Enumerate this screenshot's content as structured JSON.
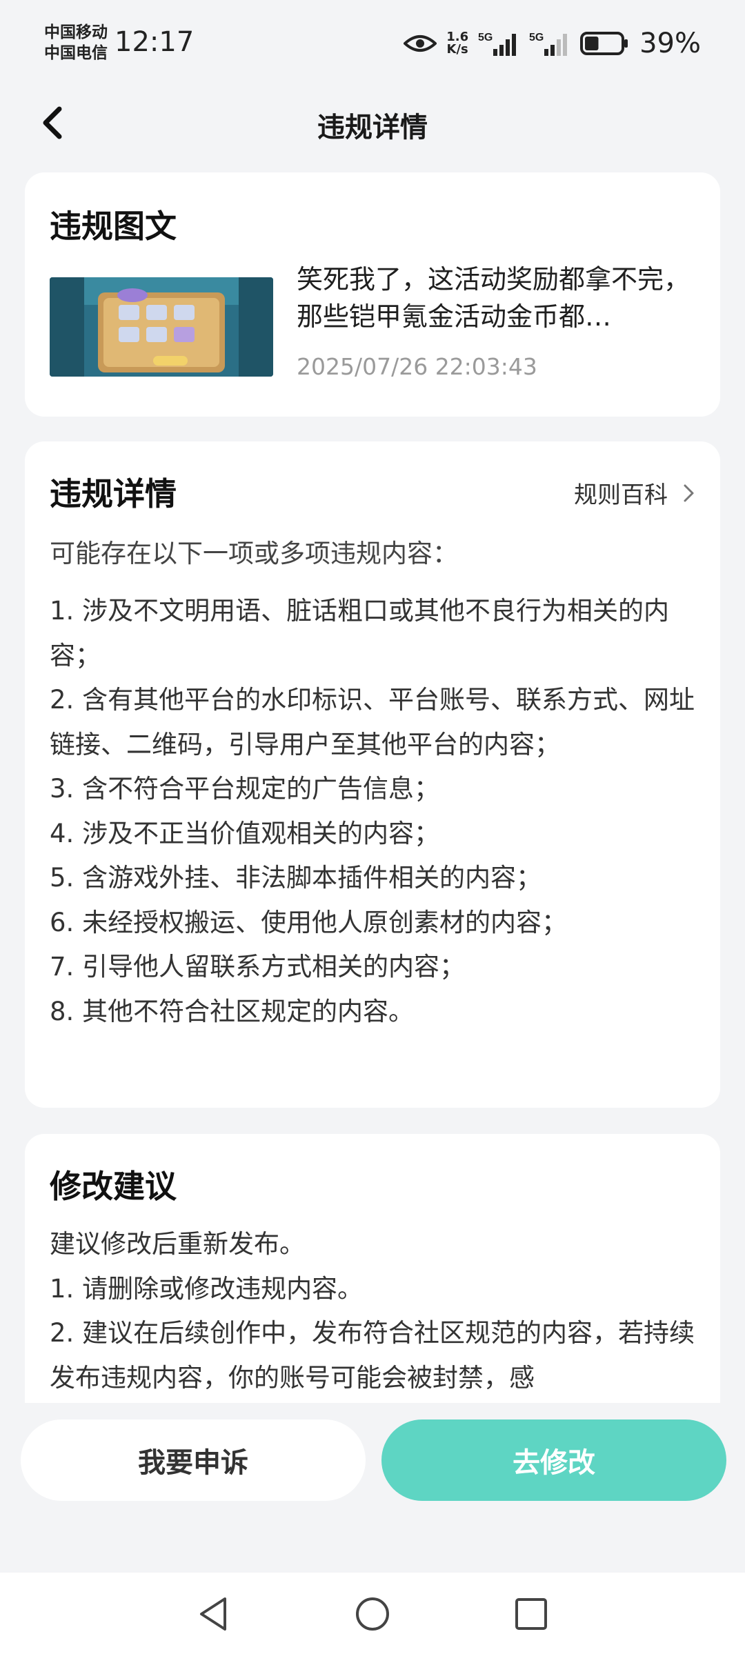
{
  "status_bar": {
    "carrier_1": "中国移动",
    "carrier_2": "中国电信",
    "time": "12:17",
    "net_speed_value": "1.6",
    "net_speed_unit": "K/s",
    "signal_1_label": "5G",
    "signal_2_label": "5G",
    "battery": "39%",
    "battery_level": 0.39,
    "icons": [
      "eye-icon",
      "signal-icon",
      "signal-icon",
      "battery-icon"
    ]
  },
  "header": {
    "title": "违规详情",
    "back_icon": "back-chevron-icon"
  },
  "violation_post": {
    "section_title": "违规图文",
    "text": "笑死我了，这活动奖励都拿不完，那些铠甲氪金活动金币都…",
    "timestamp": "2025/07/26 22:03:43"
  },
  "violation_details": {
    "section_title": "违规详情",
    "rules_link": "规则百科",
    "intro": "可能存在以下一项或多项违规内容：",
    "items": [
      "1. 涉及不文明用语、脏话粗口或其他不良行为相关的内容；",
      "2. 含有其他平台的水印标识、平台账号、联系方式、网址链接、二维码，引导用户至其他平台的内容；",
      "3. 含不符合平台规定的广告信息；",
      "4. 涉及不正当价值观相关的内容；",
      "5. 含游戏外挂、非法脚本插件相关的内容；",
      "6. 未经授权搬运、使用他人原创素材的内容；",
      "7. 引导他人留联系方式相关的内容；",
      "8. 其他不符合社区规定的内容。"
    ]
  },
  "suggestions": {
    "section_title": "修改建议",
    "lines": [
      "建议修改后重新发布。",
      "1. 请删除或修改违规内容。",
      "2. 建议在后续创作中，发布符合社区规范的内容，若持续发布违规内容，你的账号可能会被封禁，感"
    ]
  },
  "actions": {
    "appeal_label": "我要申诉",
    "modify_label": "去修改",
    "accent_color": "#5ed5c3"
  },
  "nav_bar": {
    "icons": [
      "nav-back-icon",
      "nav-home-icon",
      "nav-recent-icon"
    ]
  }
}
